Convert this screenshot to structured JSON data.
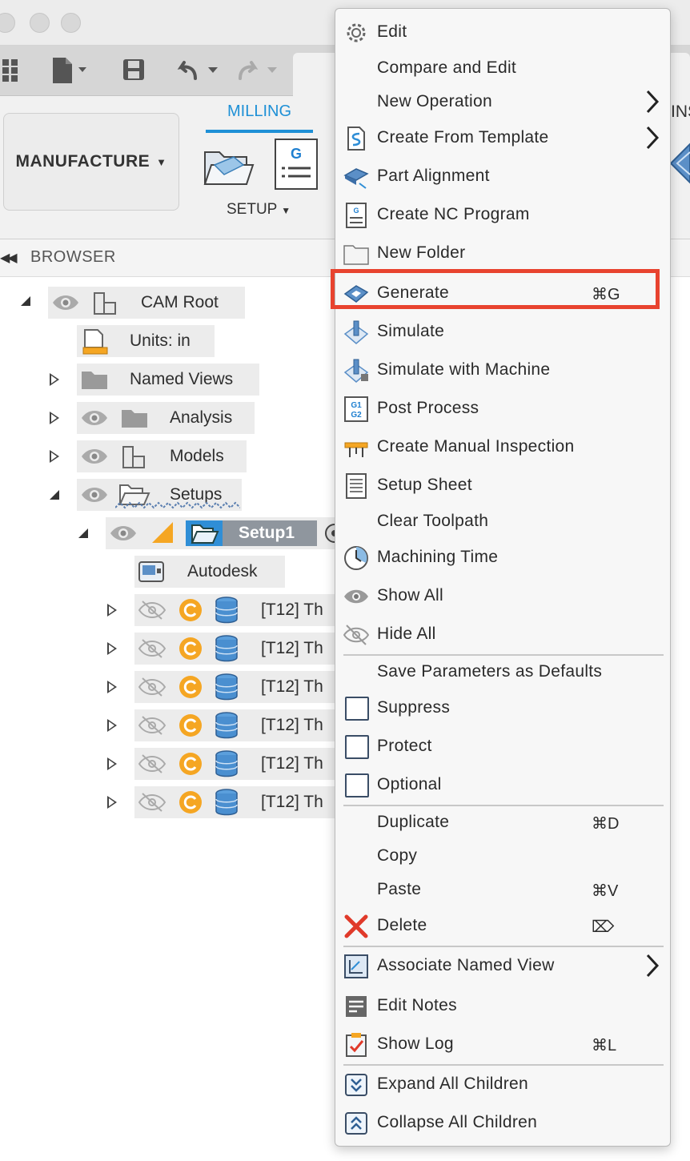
{
  "ribbon": {
    "workspace_label": "MANUFACTURE",
    "tab_label": "MILLING",
    "setup_label": "SETUP",
    "partial_tab_label": "INS",
    "accent": "#1e90d6"
  },
  "browser": {
    "title": "BROWSER",
    "tree": {
      "cam_root": "CAM Root",
      "units": "Units: in",
      "named_views": "Named Views",
      "analysis": "Analysis",
      "models": "Models",
      "setups": "Setups",
      "setup1": "Setup1",
      "machine": "Autodesk",
      "operations": [
        "[T12] Th",
        "[T12] Th",
        "[T12] Th",
        "[T12] Th",
        "[T12] Th",
        "[T12] Th"
      ]
    }
  },
  "menu": {
    "highlight_color": "#e8432f",
    "items": [
      {
        "label": "Edit",
        "icon": "gear-icon"
      },
      {
        "label": "Compare and Edit"
      },
      {
        "label": "New Operation",
        "submenu": true
      },
      {
        "label": "Create From Template",
        "icon": "template-icon",
        "submenu": true
      },
      {
        "label": "Part Alignment",
        "icon": "part-alignment-icon"
      },
      {
        "label": "Create NC Program",
        "icon": "nc-program-icon"
      },
      {
        "label": "New Folder",
        "icon": "folder-icon"
      },
      {
        "label": "Generate",
        "icon": "generate-icon",
        "shortcut": "⌘G"
      },
      {
        "label": "Simulate",
        "icon": "simulate-icon"
      },
      {
        "label": "Simulate with Machine",
        "icon": "simulate-machine-icon"
      },
      {
        "label": "Post Process",
        "icon": "post-process-icon"
      },
      {
        "label": "Create Manual Inspection",
        "icon": "inspection-icon"
      },
      {
        "label": "Setup Sheet",
        "icon": "setup-sheet-icon"
      },
      {
        "label": "Clear Toolpath"
      },
      {
        "label": "Machining Time",
        "icon": "clock-icon"
      },
      {
        "label": "Show All",
        "icon": "eye-icon"
      },
      {
        "label": "Hide All",
        "icon": "eye-hidden-icon"
      },
      {
        "label": "Save Parameters as Defaults"
      },
      {
        "label": "Suppress",
        "checkbox": true
      },
      {
        "label": "Protect",
        "checkbox": true
      },
      {
        "label": "Optional",
        "checkbox": true
      },
      {
        "label": "Duplicate",
        "shortcut": "⌘D"
      },
      {
        "label": "Copy"
      },
      {
        "label": "Paste",
        "shortcut": "⌘V"
      },
      {
        "label": "Delete",
        "icon": "delete-icon",
        "shortcut": "⌦"
      },
      {
        "label": "Associate Named View",
        "icon": "named-view-icon",
        "submenu": true
      },
      {
        "label": "Edit Notes",
        "icon": "notes-icon"
      },
      {
        "label": "Show Log",
        "icon": "log-icon",
        "shortcut": "⌘L"
      },
      {
        "label": "Expand All Children",
        "icon": "expand-icon"
      },
      {
        "label": "Collapse All Children",
        "icon": "collapse-icon"
      }
    ]
  }
}
